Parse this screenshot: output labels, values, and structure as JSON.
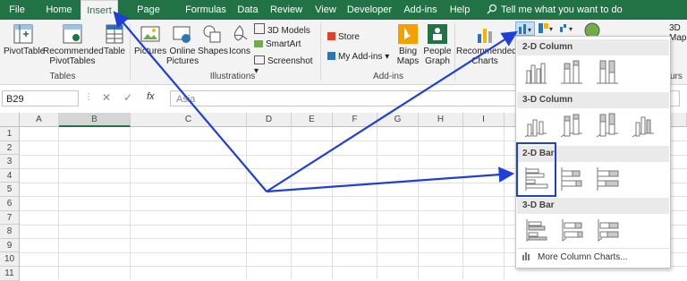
{
  "tabs": [
    "File",
    "Home",
    "Insert",
    "Page Layout",
    "Formulas",
    "Data",
    "Review",
    "View",
    "Developer",
    "Add-ins",
    "Help"
  ],
  "active_tab": "Insert",
  "tell_me": "Tell me what you want to do",
  "ribbon": {
    "pivot_table": "PivotTable",
    "recommended_pivot": [
      "Recommended",
      "PivotTables"
    ],
    "table": "Table",
    "tables_group": "Tables",
    "pictures": "Pictures",
    "online_pictures": [
      "Online",
      "Pictures"
    ],
    "shapes": "Shapes",
    "icons": "Icons",
    "models_3d": "3D Models",
    "smartart": "SmartArt",
    "screenshot": "Screenshot",
    "illustrations_group": "Illustrations",
    "store": "Store",
    "my_addins": "My Add-ins",
    "bing_maps": [
      "Bing",
      "Maps"
    ],
    "people_graph": [
      "People",
      "Graph"
    ],
    "addins_group": "Add-ins",
    "recommended_charts": [
      "Recommended",
      "Charts"
    ],
    "map_3d": [
      "3D",
      "Map"
    ],
    "tours": "urs"
  },
  "formula_bar": {
    "name_box": "B29",
    "fx": "fx",
    "value": "Asia"
  },
  "grid": {
    "columns": [
      "A",
      "B",
      "C",
      "D",
      "E",
      "F",
      "G",
      "H",
      "I"
    ],
    "selected_column": "B",
    "rows": [
      "1",
      "2",
      "3",
      "4",
      "5",
      "6",
      "7",
      "8",
      "9",
      "10",
      "11"
    ]
  },
  "dropdown": {
    "sections": [
      "2-D Column",
      "3-D Column",
      "2-D Bar",
      "3-D Bar"
    ],
    "more": "More Column Charts..."
  },
  "colors": {
    "excel_green": "#217346",
    "annotation_blue": "#1f3fd6"
  }
}
